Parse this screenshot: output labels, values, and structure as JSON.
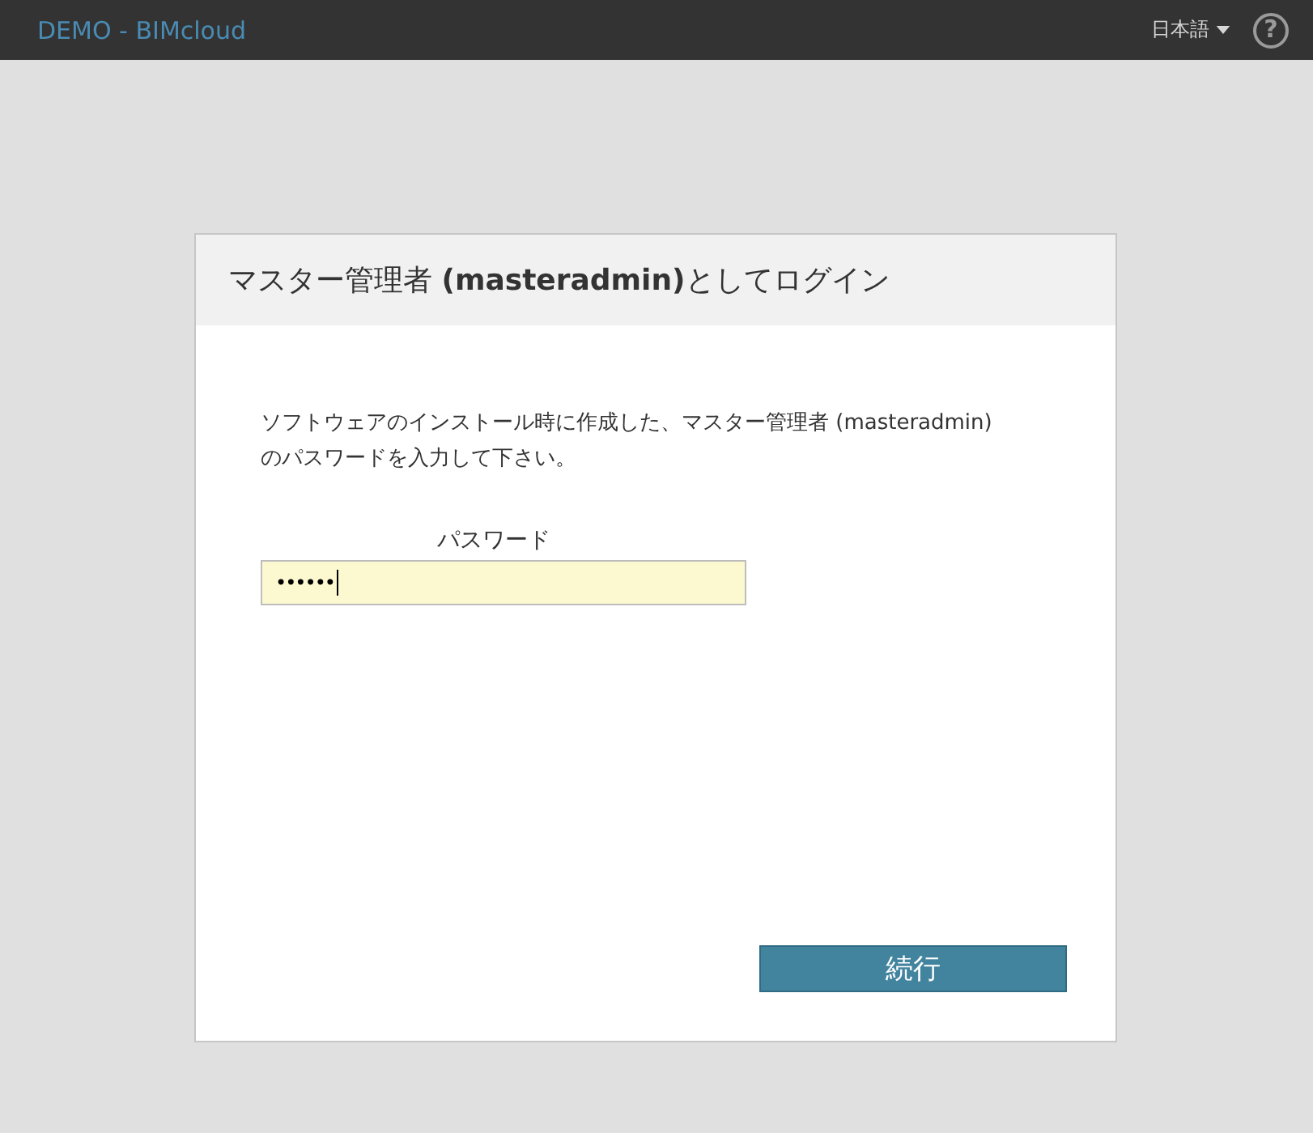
{
  "header": {
    "title": "DEMO - BIMcloud",
    "language": "日本語",
    "help": "?"
  },
  "dialog": {
    "title": "マスター管理者 **(masteradmin)**としてログイン",
    "message": "ソフトウェアのインストール時に作成した、マスター管理者 (masteradmin)\nのパスワードを入力して下さい。",
    "password": {
      "label": "パスワード",
      "value": "••••••",
      "focused": true
    },
    "submit": {
      "label": "続行"
    }
  }
}
